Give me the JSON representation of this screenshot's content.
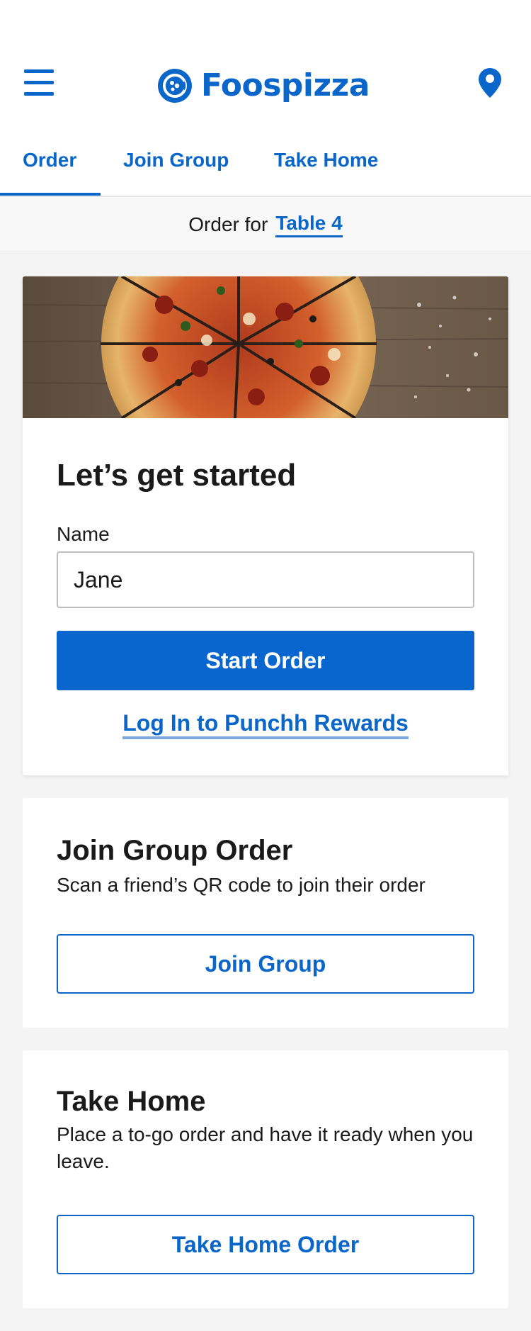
{
  "header": {
    "brand_name": "Foospizza",
    "menu_icon": "hamburger-menu-icon",
    "location_icon": "map-pin-icon",
    "brand_color": "#0a66c9"
  },
  "tabs": [
    {
      "label": "Order",
      "active": true
    },
    {
      "label": "Join Group",
      "active": false
    },
    {
      "label": "Take Home",
      "active": false
    }
  ],
  "order_for": {
    "label": "Order for",
    "table": "Table 4"
  },
  "start_card": {
    "title": "Let’s get started",
    "name_label": "Name",
    "name_value": "Jane",
    "start_button": "Start Order",
    "rewards_link": "Log In to Punchh Rewards"
  },
  "join_card": {
    "title": "Join Group Order",
    "description": "Scan a friend’s QR code to join their order",
    "button": "Join Group"
  },
  "take_card": {
    "title": "Take Home",
    "description": "Place a to-go order and have it ready when you leave.",
    "button": "Take Home Order"
  }
}
